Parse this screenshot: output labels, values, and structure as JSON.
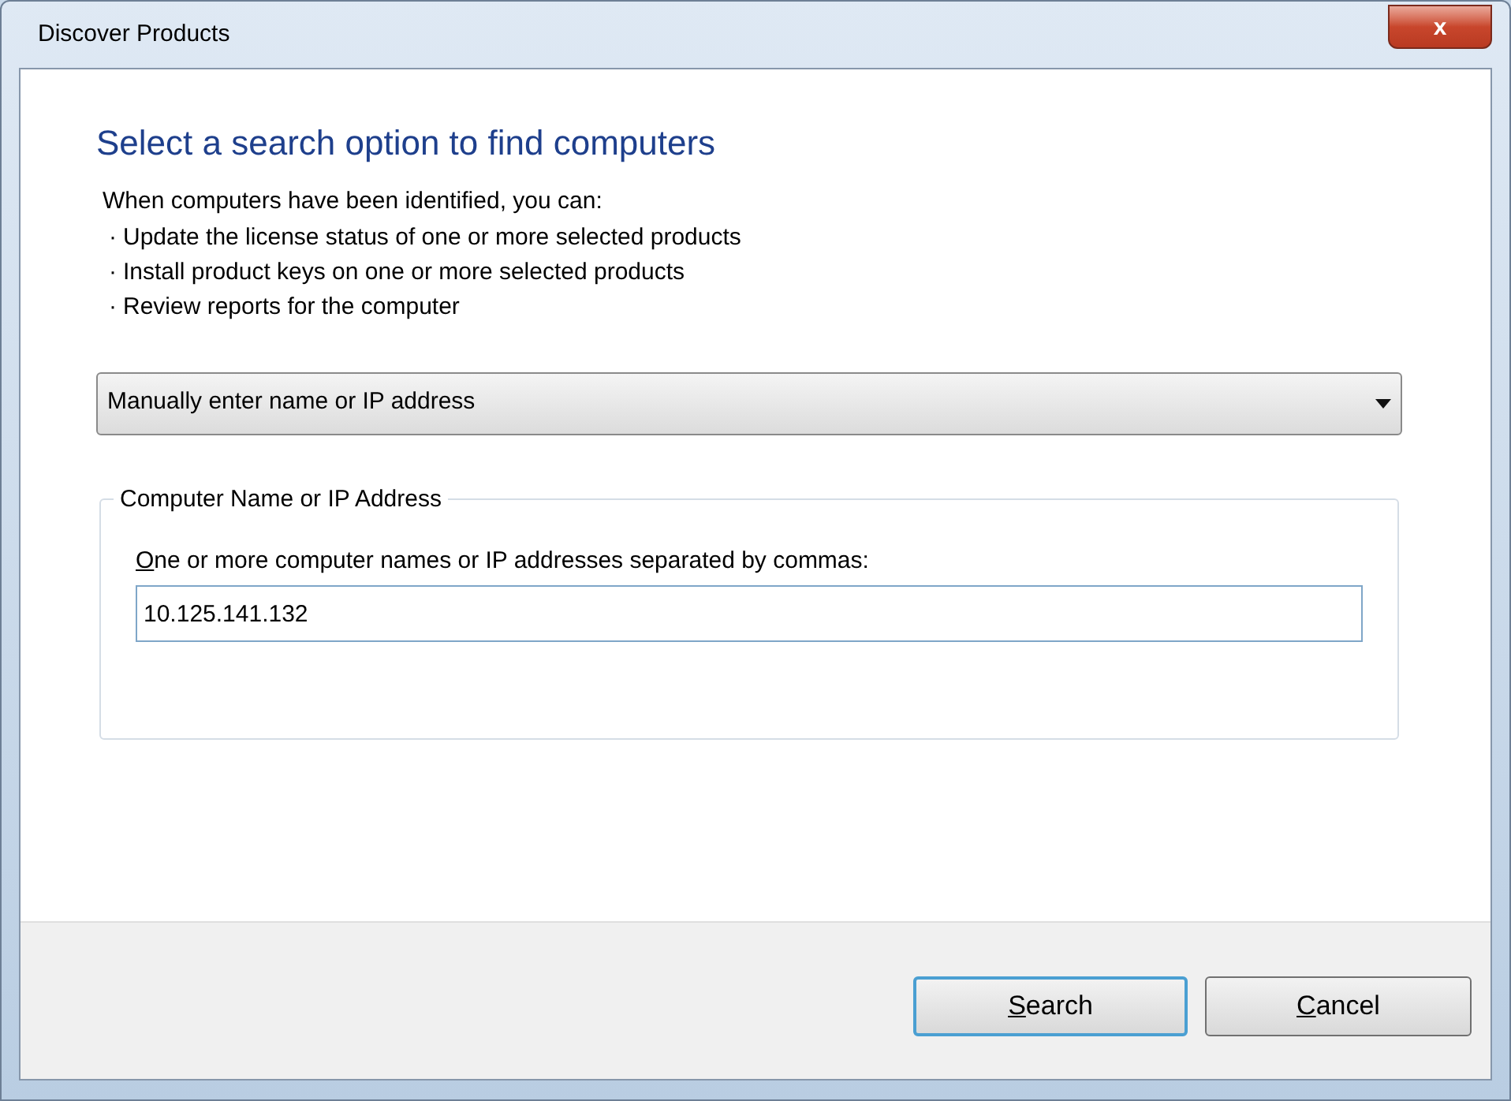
{
  "window": {
    "title": "Discover Products",
    "close": "x"
  },
  "heading": "Select a search option to find computers",
  "intro": "When computers have been identified, you can:",
  "bullets": [
    {
      "mark": "·",
      "text": "Update the license status of one or more selected products"
    },
    {
      "mark": "·",
      "text": "Install product keys on one or more selected products"
    },
    {
      "mark": "·",
      "text": "Review reports for the computer"
    }
  ],
  "search_option": {
    "value": "Manually enter name or IP address"
  },
  "group": {
    "legend": "Computer Name or IP Address",
    "label": "One or more computer names or IP addresses separated by commas:",
    "label_access_key_underlined": true,
    "value": "10.125.141.132"
  },
  "buttons": [
    {
      "label": "Search",
      "default": true,
      "access_key_underlined": true
    },
    {
      "label": "Cancel",
      "default": false,
      "access_key_underlined": true
    }
  ]
}
